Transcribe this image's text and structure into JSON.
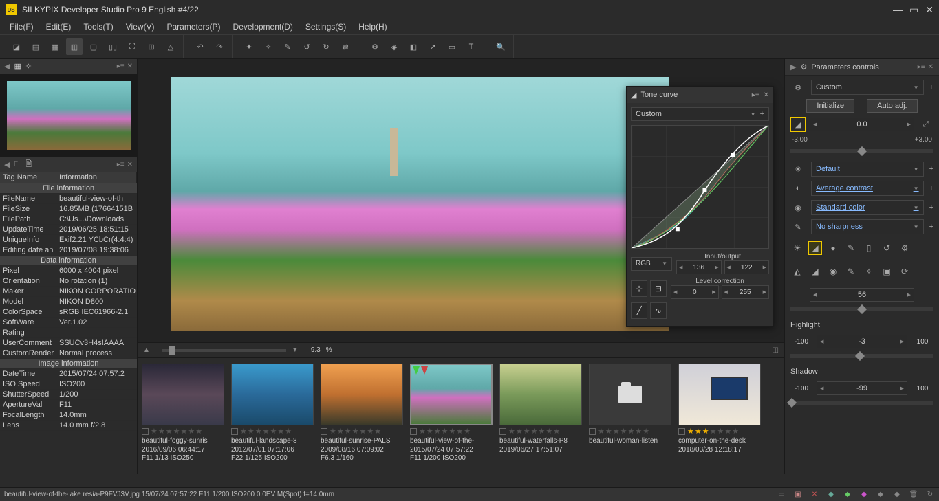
{
  "title": "SILKYPIX Developer Studio Pro 9 English   #4/22",
  "menu": [
    "File(F)",
    "Edit(E)",
    "Tools(T)",
    "View(V)",
    "Parameters(P)",
    "Development(D)",
    "Settings(S)",
    "Help(H)"
  ],
  "zoom": {
    "pct": "9.3",
    "pct_suffix": "%"
  },
  "info": {
    "col0": "Tag Name",
    "col1": "Information",
    "sections": [
      {
        "title": "File information",
        "rows": [
          [
            "FileName",
            "beautiful-view-of-th"
          ],
          [
            "FileSize",
            "16.85MB (17664151B"
          ],
          [
            "FilePath",
            "C:\\Us...\\Downloads"
          ],
          [
            "UpdateTime",
            "2019/06/25 18:51:15"
          ],
          [
            "UniqueInfo",
            "Exif2.21 YCbCr(4:4:4)"
          ],
          [
            "Editing date an",
            "2019/07/08 19:38:06"
          ]
        ]
      },
      {
        "title": "Data information",
        "rows": [
          [
            "Pixel",
            "6000 x 4004 pixel"
          ],
          [
            "Orientation",
            "No rotation (1)"
          ],
          [
            "Maker",
            "NIKON CORPORATIO"
          ],
          [
            "Model",
            "NIKON D800"
          ],
          [
            "ColorSpace",
            "sRGB IEC61966-2.1"
          ],
          [
            "SoftWare",
            "Ver.1.02"
          ],
          [
            "Rating",
            ""
          ],
          [
            "UserComment",
            "SSUCv3H4sIAAAA"
          ],
          [
            "CustomRender",
            "Normal process"
          ]
        ]
      },
      {
        "title": "Image information",
        "rows": [
          [
            "DateTime",
            "2015/07/24 07:57:2"
          ],
          [
            "ISO Speed",
            "ISO200"
          ],
          [
            "ShutterSpeed",
            "1/200"
          ],
          [
            "ApertureVal",
            "F11"
          ],
          [
            "FocalLength",
            "14.0mm"
          ],
          [
            "Lens",
            "14.0 mm f/2.8"
          ]
        ]
      }
    ]
  },
  "tone": {
    "title": "Tone curve",
    "preset": "Custom",
    "rgb": "RGB",
    "io_label": "Input/output",
    "in": "136",
    "out": "122",
    "lvl_label": "Level correction",
    "lo": "0",
    "hi": "255"
  },
  "params": {
    "title": "Parameters controls",
    "preset": "Custom",
    "initialize": "Initialize",
    "auto": "Auto adj.",
    "exposure": {
      "val": "0.0",
      "lo": "-3.00",
      "hi": "+3.00"
    },
    "wb": "Default",
    "contrast": "Average contrast",
    "color": "Standard color",
    "sharp": "No sharpness",
    "value1": "56",
    "highlight": {
      "label": "Highlight",
      "lo": "-100",
      "val": "-3",
      "hi": "100"
    },
    "shadow": {
      "label": "Shadow",
      "lo": "-100",
      "val": "-99",
      "hi": "100"
    }
  },
  "thumbs": [
    {
      "name": "beautiful-foggy-sunris",
      "date": "2016/09/06 06:44:17",
      "exp": "F11 1/13 ISO250",
      "tn": "tn1",
      "stars": 0
    },
    {
      "name": "beautiful-landscape-8",
      "date": "2012/07/01 07:17:06",
      "exp": "F22 1/125 ISO200",
      "tn": "tn2",
      "stars": 0
    },
    {
      "name": "beautiful-sunrise-PALS",
      "date": "2009/08/16 07:09:02",
      "exp": "F6.3 1/160",
      "tn": "tn3",
      "stars": 0
    },
    {
      "name": "beautiful-view-of-the-l",
      "date": "2015/07/24 07:57:22",
      "exp": "F11 1/200 ISO200",
      "tn": "tn4",
      "stars": 0,
      "selected": true,
      "marks": true
    },
    {
      "name": "beautiful-waterfalls-P8",
      "date": "2019/06/27 17:51:07",
      "exp": "",
      "tn": "tn5",
      "stars": 0
    },
    {
      "name": "beautiful-woman-listen",
      "date": "",
      "exp": "",
      "tn": "tn6",
      "stars": 0
    },
    {
      "name": "computer-on-the-desk",
      "date": "2018/03/28 12:18:17",
      "exp": "",
      "tn": "tn7",
      "stars": 3
    }
  ],
  "status": "beautiful-view-of-the-lake resia-P9FVJ3V.jpg 15/07/24 07:57:22 F11 1/200 ISO200  0.0EV M(Spot) f=14.0mm"
}
